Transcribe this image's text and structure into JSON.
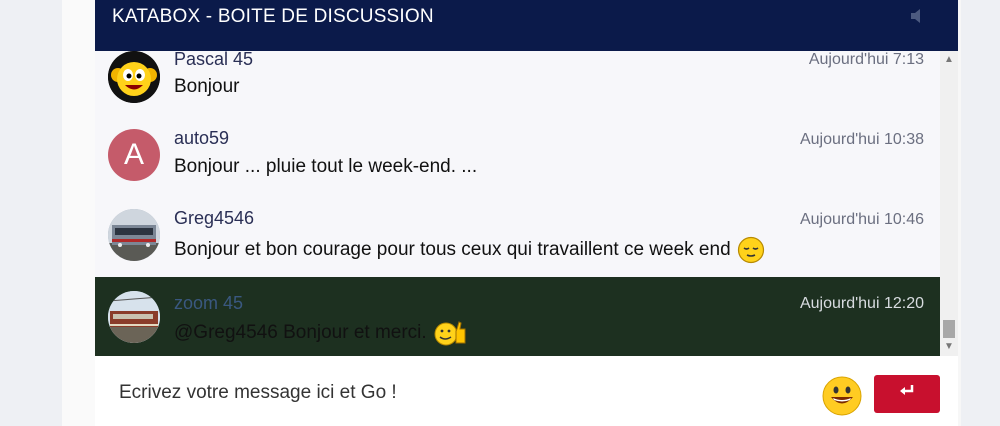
{
  "chat": {
    "title": "KATABOX - BOITE DE DISCUSSION",
    "speaker_icon": "speaker-icon",
    "messages": [
      {
        "user": "Pascal 45",
        "time": "Aujourd'hui 7:13",
        "text": "Bonjour",
        "avatar": "smiley-monkey-avatar"
      },
      {
        "user": "auto59",
        "time": "Aujourd'hui 10:38",
        "text": "Bonjour ... pluie tout le week-end. ...",
        "avatar_letter": "A"
      },
      {
        "user": "Greg4546",
        "time": "Aujourd'hui 10:46",
        "text": "Bonjour et bon courage pour tous ceux qui travaillent ce week end",
        "avatar": "train-avatar",
        "emoji": "relieved-face-emoji"
      },
      {
        "user": "zoom 45",
        "time": "Aujourd'hui 12:20",
        "text": "@Greg4546 Bonjour et merci.",
        "avatar": "train-avatar",
        "emoji": "thumbs-up-smiley-emoji",
        "highlighted": true
      }
    ],
    "composer": {
      "placeholder": "Ecrivez votre message ici et Go !",
      "send_icon": "enter-icon",
      "emoji_button_icon": "smiley-icon"
    }
  },
  "colors": {
    "header_bg": "#0b1a4a",
    "highlight_bg": "#1d3020",
    "send_button": "#c8102e",
    "avatar_letter_bg": "#c55b6a"
  }
}
